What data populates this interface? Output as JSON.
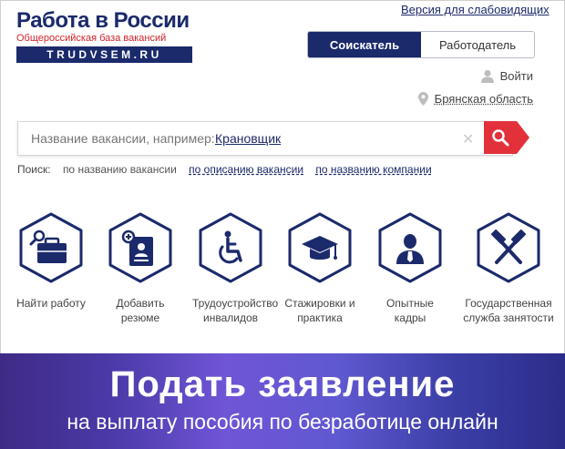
{
  "logo": {
    "title": "Работа в России",
    "subtitle": "Общероссийская база вакансий",
    "domain": "TRUDVSEM.RU"
  },
  "header": {
    "vision_link": "Версия для слабовидящих",
    "roles": {
      "jobseeker": "Соискатель",
      "employer": "Работодатель",
      "active": "jobseeker"
    },
    "login": "Войти",
    "region": "Брянская область"
  },
  "search": {
    "placeholder": "Название вакансии, например:",
    "example": "Крановщик",
    "modes_label": "Поиск:",
    "modes": [
      "по названию вакансии",
      "по описанию вакансии",
      "по названию компании"
    ]
  },
  "services": [
    {
      "label": "Найти работу",
      "icon": "briefcase-search-icon"
    },
    {
      "label": "Добавить резюме",
      "icon": "add-resume-icon"
    },
    {
      "label": "Трудоустройство инвалидов",
      "icon": "wheelchair-icon"
    },
    {
      "label": "Стажировки и практика",
      "icon": "graduation-cap-icon"
    },
    {
      "label": "Опытные кадры",
      "icon": "person-tie-icon"
    },
    {
      "label": "Государственная служба занятости",
      "icon": "crossed-hammers-icon"
    }
  ],
  "banner": {
    "title": "Подать заявление",
    "subtitle": "на выплату пособия по безработице онлайн"
  },
  "colors": {
    "brand": "#1b2a6b",
    "accent_red": "#e2313b",
    "banner_purple": "#5f58d0"
  }
}
